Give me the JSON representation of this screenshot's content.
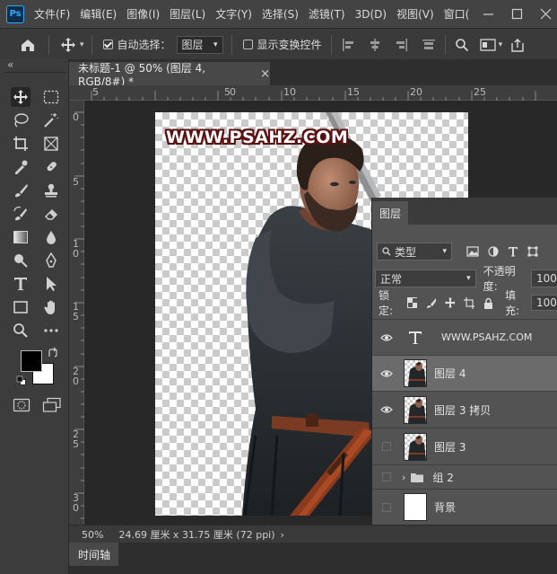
{
  "menubar": {
    "logo": "Ps",
    "items": [
      "文件(F)",
      "编辑(E)",
      "图像(I)",
      "图层(L)",
      "文字(Y)",
      "选择(S)",
      "滤镜(T)",
      "3D(D)",
      "视图(V)",
      "窗口("
    ]
  },
  "options": {
    "auto_select_label": "自动选择：",
    "auto_select_target": "图层",
    "show_transform_label": "显示变换控件"
  },
  "panel_collapse": "«",
  "document": {
    "tab_title": "未标题-1 @ 50% (图层 4, RGB/8#) *",
    "close": "×",
    "watermark": "WWW.PSAHZ.COM"
  },
  "rulers": {
    "h_labels": [
      "5",
      "0",
      "5",
      "10",
      "15",
      "20",
      "25"
    ],
    "v_labels": [
      "0",
      "5",
      "1\n0",
      "1\n5",
      "2\n0",
      "2\n5",
      "3\n0"
    ]
  },
  "statusbar": {
    "zoom": "50%",
    "doc_size": "24.69 厘米 x 31.75 厘米 (72 ppi)",
    "arrow": "›"
  },
  "timeline": {
    "tab": "时间轴"
  },
  "layers_panel": {
    "tab": "图层",
    "filter_label": "类型",
    "blend_mode": "正常",
    "opacity_label": "不透明度:",
    "opacity_value": "100",
    "lock_label": "锁定:",
    "fill_label": "填充:",
    "fill_value": "100",
    "layers": [
      {
        "name": "WWW.PSAHZ.COM",
        "visible": true,
        "kind": "text",
        "selected": false
      },
      {
        "name": "图层 4",
        "visible": true,
        "kind": "image",
        "selected": true
      },
      {
        "name": "图层 3 拷贝",
        "visible": true,
        "kind": "image",
        "selected": false
      },
      {
        "name": "图层 3",
        "visible": false,
        "kind": "image",
        "selected": false
      },
      {
        "name": "组 2",
        "visible": false,
        "kind": "group",
        "selected": false
      },
      {
        "name": "背景",
        "visible": false,
        "kind": "background",
        "selected": false
      }
    ]
  },
  "colors": {
    "foreground": "#000000",
    "background": "#ffffff",
    "selected_layer": "#6b6b6b",
    "watermark_outline": "#5a1010"
  }
}
